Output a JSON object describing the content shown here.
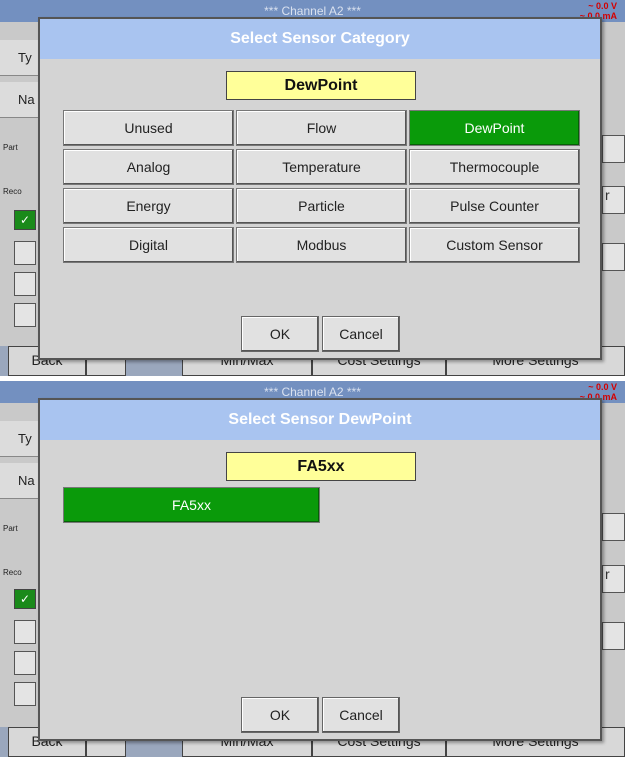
{
  "background": {
    "header_title": "*** Channel A2 ***",
    "voltage": "~ 0.0 V",
    "current": "~ 0.0 mA",
    "type_label": "Ty",
    "name_label": "Na",
    "part_label": "Part",
    "record_label": "Reco",
    "right_label": "r",
    "footer": [
      "Back",
      "",
      "Min/Max",
      "Cost Settings",
      "More Settings"
    ]
  },
  "dialog1": {
    "title": "Select Sensor Category",
    "selected": "DewPoint",
    "options": [
      "Unused",
      "Flow",
      "DewPoint",
      "Analog",
      "Temperature",
      "Thermocouple",
      "Energy",
      "Particle",
      "Pulse Counter",
      "Digital",
      "Modbus",
      "Custom Sensor"
    ],
    "ok_label": "OK",
    "cancel_label": "Cancel"
  },
  "dialog2": {
    "title": "Select Sensor DewPoint",
    "selected": "FA5xx",
    "option": "FA5xx",
    "ok_label": "OK",
    "cancel_label": "Cancel"
  },
  "colors": {
    "title_bar": "#a9c4f0",
    "selected_box": "#ffff99",
    "active_green": "#0a9a0a"
  }
}
